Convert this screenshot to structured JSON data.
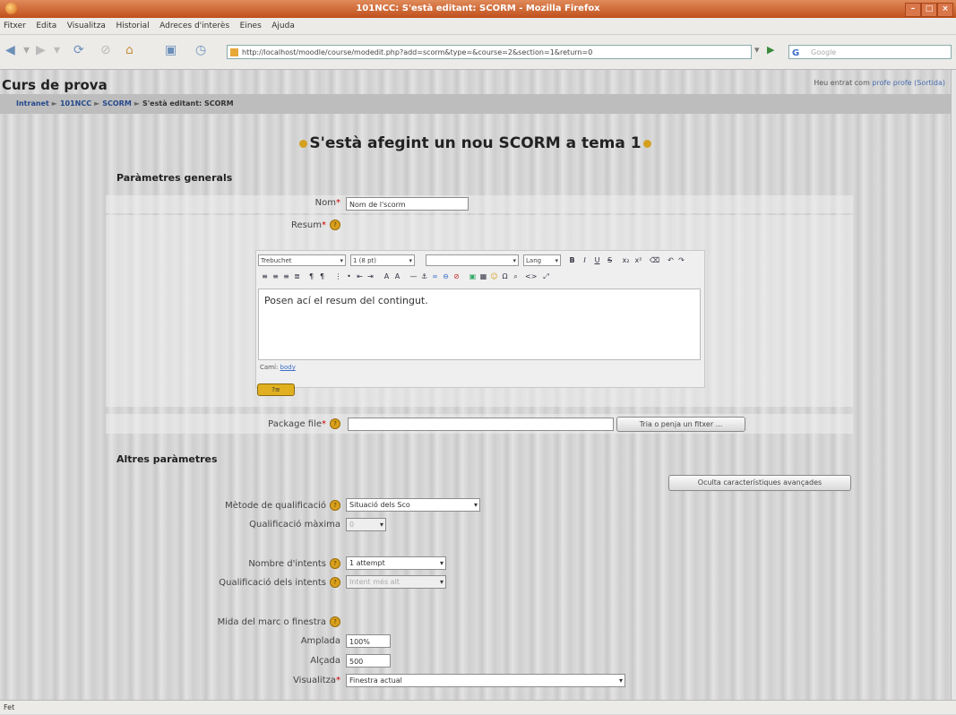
{
  "window": {
    "title": "101NCC: S'està editant: SCORM - Mozilla Firefox"
  },
  "menu": [
    "Fitxer",
    "Edita",
    "Visualitza",
    "Historial",
    "Adreces d'interès",
    "Eines",
    "Ajuda"
  ],
  "nav": {
    "url": "http://localhost/moodle/course/modedit.php?add=scorm&type=&course=2&section=1&return=0",
    "search_placeholder": "Google"
  },
  "page": {
    "site_title": "Curs de prova",
    "login_text": "Heu entrat com",
    "login_user": "profe profe",
    "logout": "(Sortida)",
    "breadcrumbs": [
      "Intranet",
      "101NCC",
      "SCORM",
      "S'està editant: SCORM"
    ],
    "heading": "S'està afegint un nou SCORM a tema 1"
  },
  "general": {
    "legend": "Paràmetres generals",
    "name_label": "Nom",
    "name_value": "Nom de l'scorm",
    "summary_label": "Resum",
    "editor": {
      "font": "Trebuchet",
      "size": "1 (8 pt)",
      "format": "",
      "lang": "Lang",
      "content": "Posen ací el resum del contingut.",
      "path_label": "Camí:",
      "path_value": "body"
    },
    "package_label": "Package file",
    "browse_button": "Tria o penja un fitxer ..."
  },
  "other": {
    "legend": "Altres paràmetres",
    "advanced_button": "Oculta característiques avançades",
    "grading_method_label": "Mètode de qualificació",
    "grading_method_value": "Situació dels Sco",
    "max_grade_label": "Qualificació màxima",
    "max_grade_value": "0",
    "attempts_label": "Nombre d'intents",
    "attempts_value": "1 attempt",
    "attempts_grading_label": "Qualificació dels intents",
    "attempts_grading_value": "Intent més alt",
    "frame_label": "Mida del marc o finestra",
    "width_label": "Amplada",
    "width_value": "100%",
    "height_label": "Alçada",
    "height_value": "500",
    "display_label": "Visualitza",
    "display_value": "Finestra actual"
  },
  "status_bar": "Fet"
}
